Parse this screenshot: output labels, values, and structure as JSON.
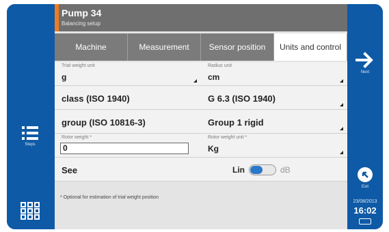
{
  "header": {
    "title": "Pump 34",
    "subtitle": "Balancing setup"
  },
  "tabs": [
    {
      "label": "Machine",
      "active": false
    },
    {
      "label": "Measurement",
      "active": false
    },
    {
      "label": "Sensor position",
      "active": false
    },
    {
      "label": "Units and control",
      "active": true
    }
  ],
  "form": {
    "trial_weight_unit": {
      "label": "Trial weight unit",
      "value": "g"
    },
    "radius_unit": {
      "label": "Radius unit",
      "value": "cm"
    },
    "class_label": "class (ISO 1940)",
    "class_value": "G 6.3 (ISO 1940)",
    "group_label": "group (ISO 10816-3)",
    "group_value": "Group 1 rigid",
    "rotor_weight": {
      "label": "Rotor weight *",
      "value": "0"
    },
    "rotor_weight_unit": {
      "label": "Rotor weight unit *",
      "value": "Kg"
    },
    "see_label": "See",
    "toggle_left": "Lin",
    "toggle_right": "dB"
  },
  "note": "* Optional for estimation of trial weight position",
  "left_nav": {
    "steps_label": "Steps"
  },
  "right_nav": {
    "next_label": "Next",
    "exit_label": "Exit",
    "date": "23/08/2013",
    "time": "16:02"
  },
  "colors": {
    "frame": "#0e5aa6",
    "header": "#6f6f6f",
    "accent": "#f07c20",
    "toggle": "#2a78c8"
  }
}
